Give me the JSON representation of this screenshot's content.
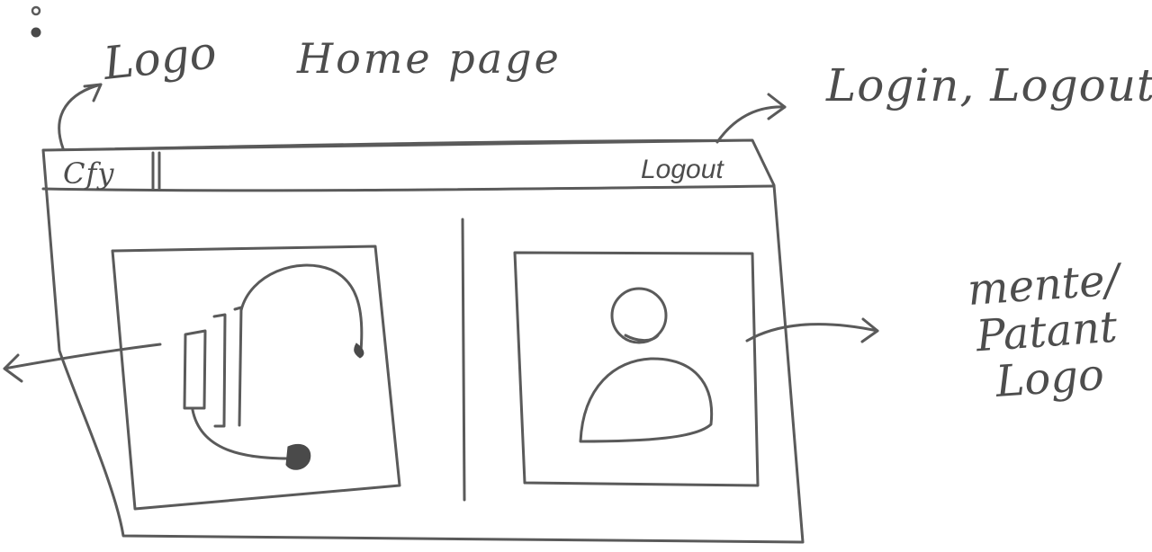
{
  "title": "Home page",
  "annotations": {
    "logo": "Logo",
    "auth": "Login, Logout",
    "mentee_patient": "mente/ Patant Logo"
  },
  "header": {
    "brand_text": "Cfy",
    "logout_label": "Logout"
  },
  "panels": [
    {
      "icon": "headset-icon",
      "label": ""
    },
    {
      "icon": "user-icon",
      "label": ""
    }
  ],
  "colors": {
    "ink": "#5a5a5a",
    "paper": "#ffffff"
  }
}
